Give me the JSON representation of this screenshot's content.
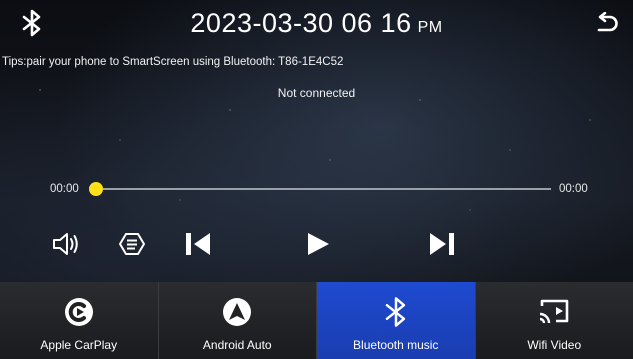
{
  "header": {
    "bluetooth_icon": "bluetooth-icon",
    "datetime": "2023-03-30 06 16",
    "ampm": "PM",
    "back_icon": "back-arrow-icon"
  },
  "main": {
    "tips": "Tips:pair your phone to SmartScreen using Bluetooth: T86-1E4C52",
    "connection_status": "Not connected",
    "elapsed": "00:00",
    "duration": "00:00",
    "progress": 0,
    "accent": "#ffe11a"
  },
  "controls": [
    {
      "name": "volume-icon"
    },
    {
      "name": "playlist-icon"
    },
    {
      "name": "previous-icon"
    },
    {
      "name": "play-icon"
    },
    {
      "name": "next-icon"
    }
  ],
  "bottom_nav": {
    "active_color": "#1e4bd1",
    "items": [
      {
        "label": "Apple CarPlay",
        "icon": "carplay-icon"
      },
      {
        "label": "Android Auto",
        "icon": "android-auto-icon"
      },
      {
        "label": "Bluetooth music",
        "icon": "bluetooth-icon",
        "active": true
      },
      {
        "label": "Wifi Video",
        "icon": "screen-cast-icon"
      }
    ]
  }
}
